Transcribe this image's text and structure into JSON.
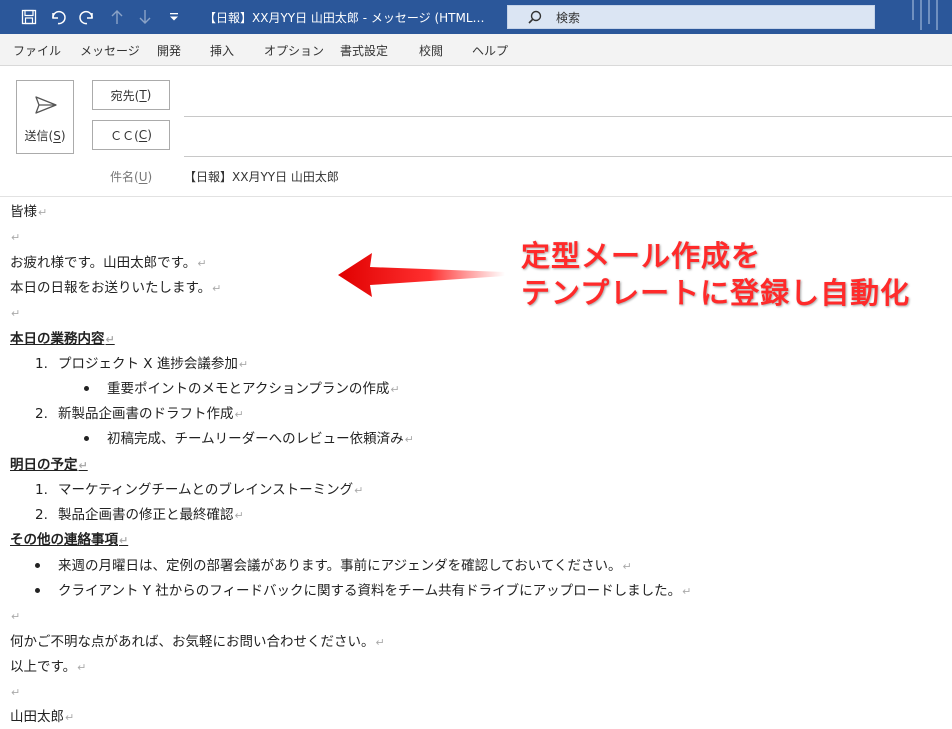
{
  "window": {
    "title": "【日報】XX月YY日 山田太郎  -  メッセージ (HTML…",
    "search_label": "検索"
  },
  "menu": [
    "ファイル",
    "メッセージ",
    "開発",
    "挿入",
    "オプション",
    "書式設定",
    "校閲",
    "ヘルプ"
  ],
  "header": {
    "send_text": "送信(",
    "send_key": "S",
    "send_close": ")",
    "to_text": "宛先(",
    "to_key": "T",
    "to_close": ")",
    "cc_text": "ＣＣ(",
    "cc_key": "C",
    "cc_close": ")",
    "subject_text": "件名(",
    "subject_key": "U",
    "subject_close": ")",
    "subject_value": "【日報】XX月YY日 山田太郎"
  },
  "body": {
    "greeting": "皆様",
    "line1": "お疲れ様です。山田太郎です。",
    "line2": "本日の日報をお送りいたします。",
    "sec1_title": "本日の業務内容",
    "sec1_num1": "1.",
    "sec1_item1": "プロジェクト X 進捗会議参加",
    "sec1_item1_sub": "重要ポイントのメモとアクションプランの作成",
    "sec1_num2": "2.",
    "sec1_item2": "新製品企画書のドラフト作成",
    "sec1_item2_sub": "初稿完成、チームリーダーへのレビュー依頼済み",
    "sec2_title": "明日の予定",
    "sec2_num1": "1.",
    "sec2_item1": "マーケティングチームとのブレインストーミング",
    "sec2_num2": "2.",
    "sec2_item2": "製品企画書の修正と最終確認",
    "sec3_title": "その他の連絡事項",
    "sec3_item1": "来週の月曜日は、定例の部署会議があります。事前にアジェンダを確認しておいてください。",
    "sec3_item2": "クライアント Y 社からのフィードバックに関する資料をチーム共有ドライブにアップロードしました。",
    "closing1": "何かご不明な点があれば、お気軽にお問い合わせください。",
    "closing2": "以上です。",
    "signature": "山田太郎",
    "para_mark": "↵"
  },
  "annotation": {
    "line1": "定型メール作成を",
    "line2": "テンプレートに登録し自動化",
    "color": "#ff2a2a"
  },
  "colors": {
    "titlebar": "#2b579a",
    "menubar": "#f3f3f3",
    "search": "#dbe5f3"
  }
}
